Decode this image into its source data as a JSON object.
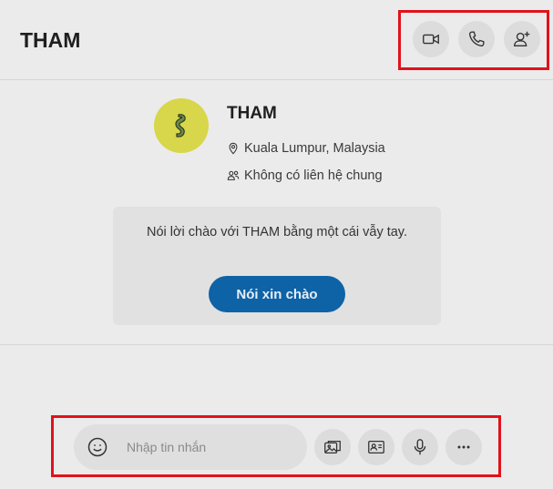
{
  "header": {
    "contact_name": "THAM",
    "actions": [
      {
        "name": "video-call",
        "icon": "video-camera-icon"
      },
      {
        "name": "audio-call",
        "icon": "phone-icon"
      },
      {
        "name": "add-people",
        "icon": "add-person-icon"
      }
    ]
  },
  "profile": {
    "name": "THAM",
    "location": "Kuala Lumpur, Malaysia",
    "mutual_contacts": "Không có liên hệ chung",
    "avatar_icon": "dinosaur-avatar"
  },
  "greeting": {
    "message": "Nói lời chào với THAM bằng một cái vẫy tay.",
    "button_label": "Nói xin chào"
  },
  "composer": {
    "placeholder": "Nhập tin nhắn",
    "value": "",
    "tools": [
      "media-icon",
      "contact-card-icon",
      "microphone-icon",
      "more-icon"
    ]
  },
  "colors": {
    "highlight": "#e0121b",
    "primary_button": "#0e62a6",
    "background": "#ebebeb"
  }
}
